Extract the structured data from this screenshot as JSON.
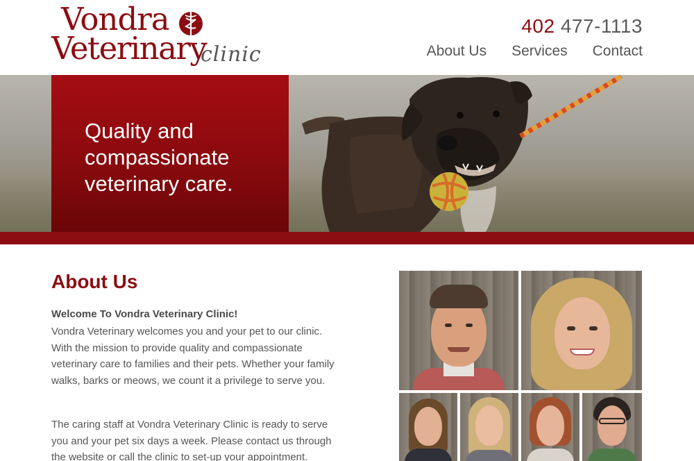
{
  "header": {
    "logo": {
      "line1": "Vondra",
      "line2": "Veterinary",
      "line3": "clinic"
    },
    "phone": {
      "area_code": "402",
      "number": "477-1113"
    },
    "nav": [
      {
        "label": "About Us"
      },
      {
        "label": "Services"
      },
      {
        "label": "Contact"
      }
    ]
  },
  "hero": {
    "tagline": "Quality and compassionate veterinary care."
  },
  "about": {
    "title": "About Us",
    "welcome": "Welcome To Vondra Veterinary Clinic!",
    "paragraph1": "Vondra Veterinary welcomes you and your pet to our clinic. With the mission to provide quality and compassionate veterinary care to families and their pets.  Whether your family walks, barks or meows, we count it a privilege to serve you.",
    "paragraph2": "The caring staff at Vondra Veterinary Clinic is ready to serve you and your pet six days a week. Please contact us through the website or call the clinic to set-up your appointment."
  },
  "colors": {
    "brand_red": "#8b0d12",
    "text_gray": "#555555"
  }
}
